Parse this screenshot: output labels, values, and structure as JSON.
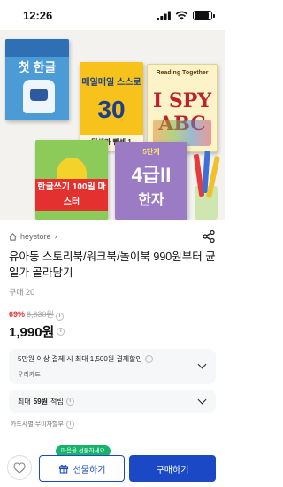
{
  "status_bar": {
    "time": "12:26",
    "battery_level": 0.9
  },
  "product_image": {
    "book1_title": "첫 한글",
    "book2_title": "매일매일 스스로",
    "book2_number": "30",
    "book2_bottom": "덧셈과 뺄셈 1",
    "book3_top": "Reading Together",
    "book3_title": "I SPY ABC",
    "book4_banner": "한글쓰기 100일 마스터",
    "book5_top": "5단계",
    "book5_grade": "4급II",
    "book5_title": "한자"
  },
  "store": {
    "name": "heystore",
    "chevron": "›"
  },
  "product": {
    "title": "유아동 스토리북/워크북/놀이북 990원부터 균일가 골라담기",
    "purchase_count": "구매 20"
  },
  "price": {
    "discount": "69%",
    "original": "6,630원",
    "sale": "1,990원",
    "info_icon": "i"
  },
  "benefit_card": {
    "text": "5만원 이상 결제 시 최대 1,500원 결제할인",
    "card_name": "우리카드"
  },
  "points_card": {
    "prefix": "최대",
    "amount": "59원",
    "suffix": "적립"
  },
  "card_free_installment": "카드사별 무이자할부",
  "bottom_bar": {
    "tooltip": "마음을 선물하세요",
    "gift_label": "선물하기",
    "buy_label": "구매하기"
  },
  "colors": {
    "accent": "#1b49c5",
    "discount": "#e8333a",
    "tooltip": "#18b36a"
  }
}
